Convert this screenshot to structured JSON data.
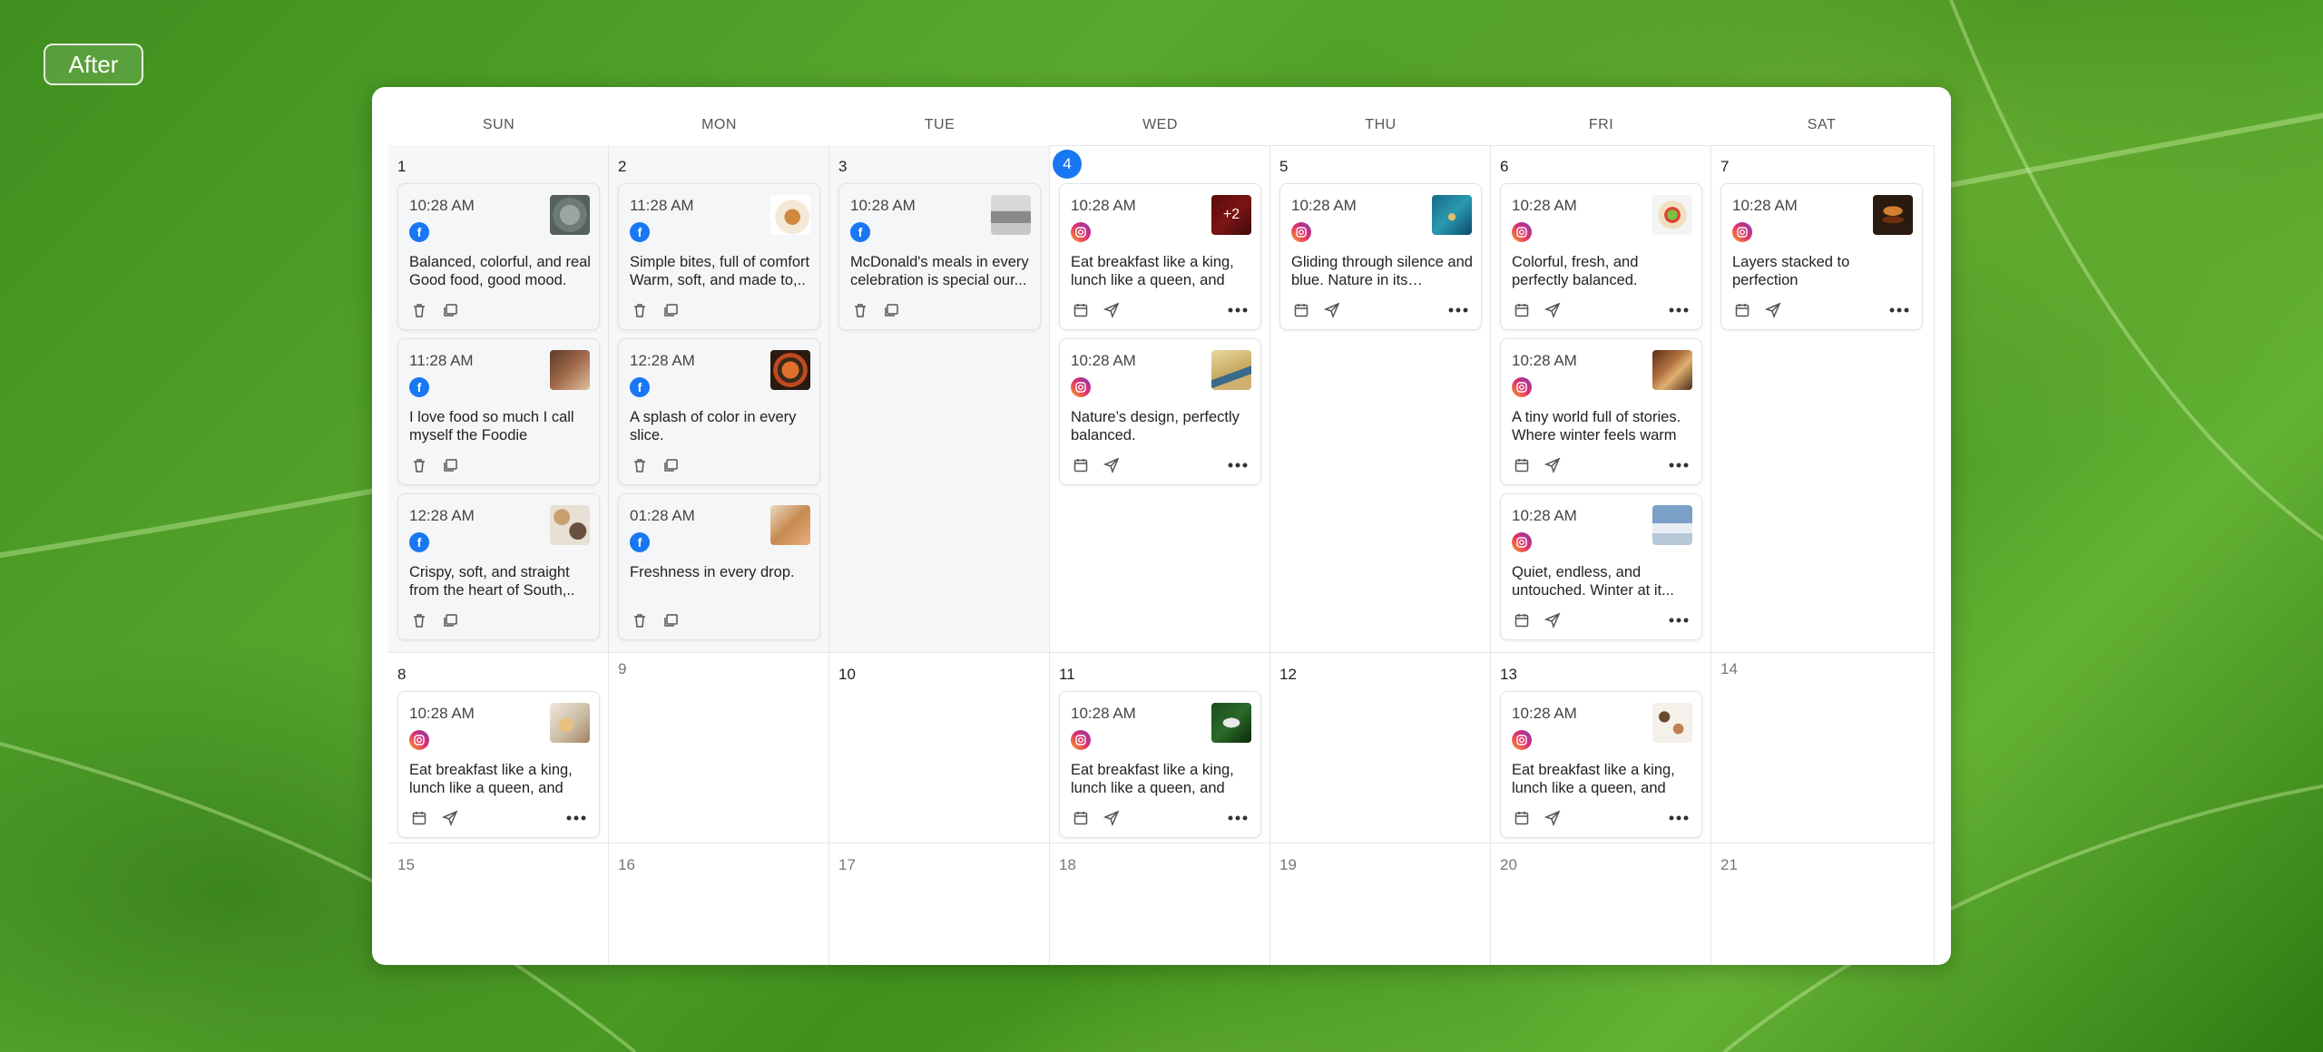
{
  "after_button": "After",
  "weekdays": [
    "SUN",
    "MON",
    "TUE",
    "WED",
    "THU",
    "FRI",
    "SAT"
  ],
  "week1": {
    "days": [
      "1",
      "2",
      "3",
      "4",
      "5",
      "6",
      "7"
    ],
    "sun": [
      {
        "time": "10:28 AM",
        "text": "Balanced, colorful, and real Good food, good mood."
      },
      {
        "time": "11:28 AM",
        "text": "I love food so much I call myself the Foodie"
      },
      {
        "time": "12:28 AM",
        "text": "Crispy, soft, and straight from the heart of South,.."
      }
    ],
    "mon": [
      {
        "time": "11:28 AM",
        "text": "Simple bites, full of comfort Warm, soft, and made to,.."
      },
      {
        "time": "12:28 AM",
        "text": "A splash of color in every slice."
      },
      {
        "time": "01:28 AM",
        "text": "Freshness in every drop."
      }
    ],
    "tue": [
      {
        "time": "10:28 AM",
        "text": "McDonald's meals in every celebration is special our..."
      }
    ],
    "wed": [
      {
        "time": "10:28 AM",
        "text": "Eat breakfast like a king, lunch like a queen, and",
        "badge": "+2"
      },
      {
        "time": "10:28 AM",
        "text": "Nature’s design, perfectly balanced."
      }
    ],
    "thu": [
      {
        "time": "10:28 AM",
        "text": "Gliding through silence and blue. Nature in its calmest..."
      }
    ],
    "fri": [
      {
        "time": "10:28 AM",
        "text": "Colorful, fresh, and perfectly balanced."
      },
      {
        "time": "10:28 AM",
        "text": "A tiny world full of stories. Where winter feels warm"
      },
      {
        "time": "10:28 AM",
        "text": "Quiet, endless, and untouched. Winter at it..."
      }
    ],
    "sat": [
      {
        "time": "10:28 AM",
        "text": "Layers stacked to perfection"
      }
    ]
  },
  "week2": {
    "days": [
      "8",
      "9",
      "10",
      "11",
      "12",
      "13",
      "14"
    ],
    "sun": {
      "time": "10:28 AM",
      "text": "Eat breakfast like a king, lunch like a queen, and"
    },
    "wed": {
      "time": "10:28 AM",
      "text": "Eat breakfast like a king, lunch like a queen, and"
    },
    "fri": {
      "time": "10:28 AM",
      "text": "Eat breakfast like a king, lunch like a queen, and"
    }
  },
  "week3": {
    "days": [
      "15",
      "16",
      "17",
      "18",
      "19",
      "20",
      "21"
    ]
  },
  "colors": {
    "facebook": "#1877f2",
    "today": "#1877f2"
  }
}
